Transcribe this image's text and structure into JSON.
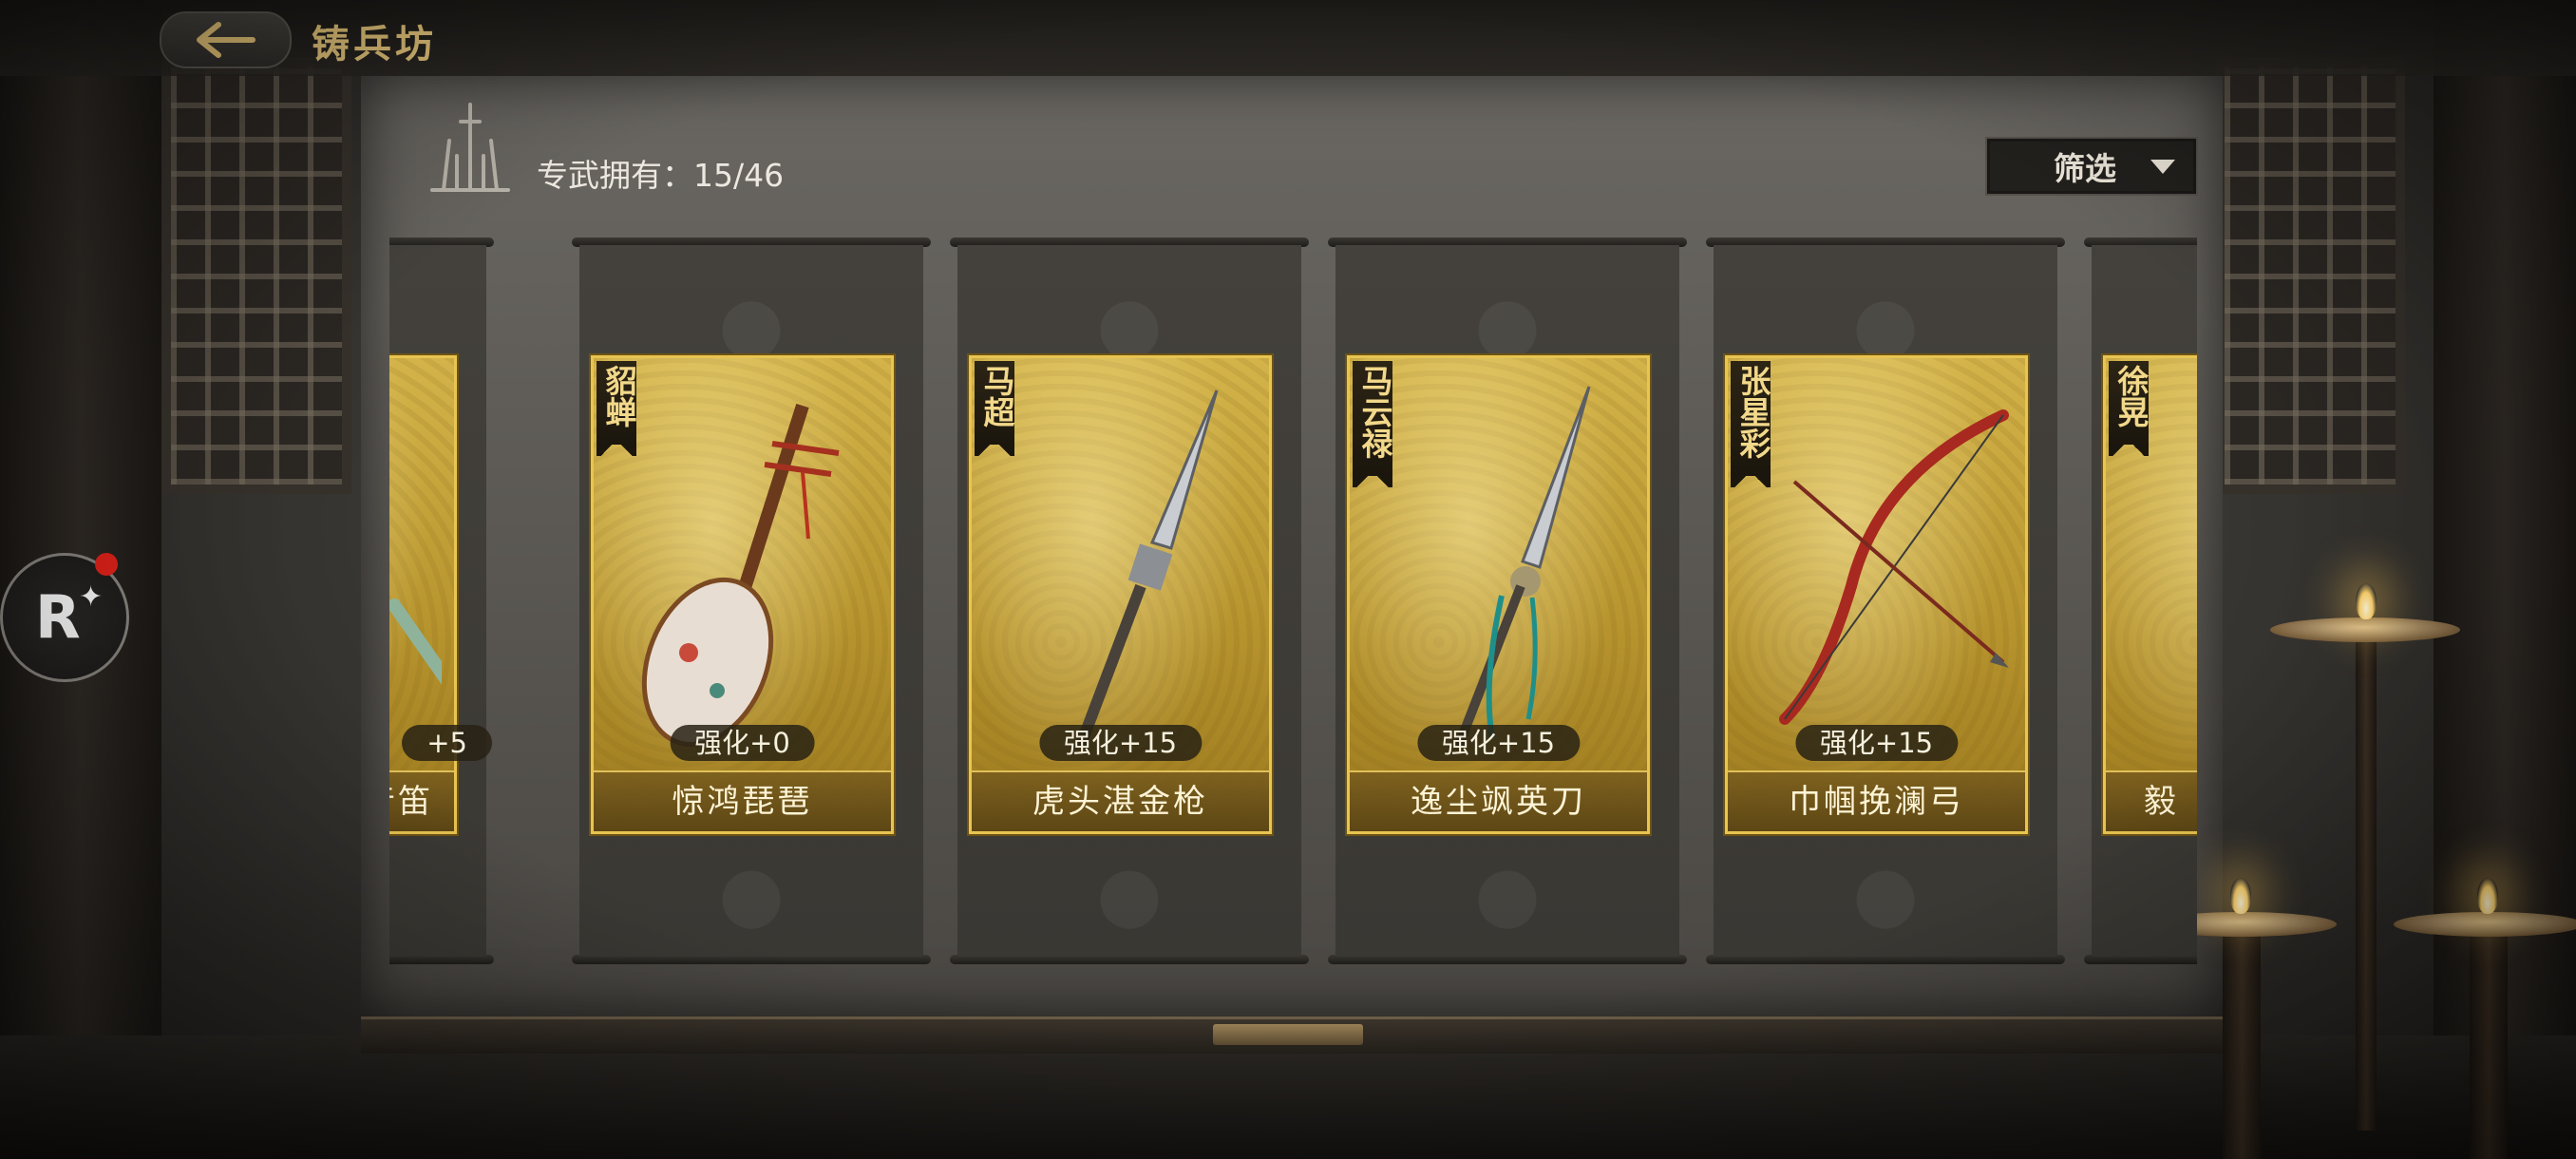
{
  "header": {
    "title": "铸兵坊",
    "back_icon": "arrow-left-icon"
  },
  "collection": {
    "label": "专武拥有：15/46",
    "icon": "weapon-rack-icon"
  },
  "filter": {
    "label": "筛选",
    "icon": "triangle-down-icon"
  },
  "weapons": [
    {
      "hero": "",
      "name": "音笛",
      "enhance": "+5",
      "art": "flute"
    },
    {
      "hero": "貂蝉",
      "name": "惊鸿琵琶",
      "enhance": "强化+0",
      "art": "pipa"
    },
    {
      "hero": "马超",
      "name": "虎头湛金枪",
      "enhance": "强化+15",
      "art": "spear"
    },
    {
      "hero": "马云禄",
      "name": "逸尘飒英刀",
      "enhance": "强化+15",
      "art": "halberd"
    },
    {
      "hero": "张星彩",
      "name": "巾帼挽澜弓",
      "enhance": "强化+15",
      "art": "bow"
    },
    {
      "hero": "徐晃",
      "name": "毅",
      "enhance": "",
      "art": "axe"
    }
  ],
  "floating": {
    "label": "R",
    "badge_color": "#e2221a"
  },
  "colors": {
    "gold": "#e5c57a",
    "card_border": "#e8c451",
    "badge_red": "#e2221a"
  }
}
